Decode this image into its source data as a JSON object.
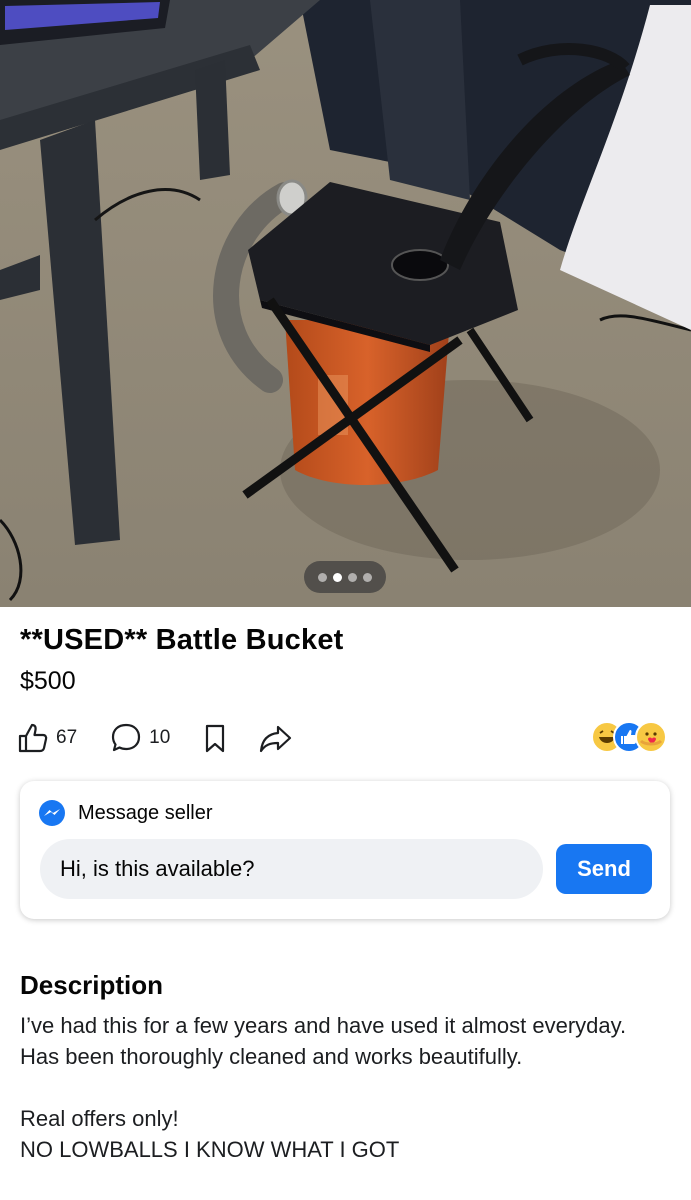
{
  "listing": {
    "title": "**USED** Battle Bucket",
    "price": "$500"
  },
  "gallery": {
    "photo_count": 4,
    "active_index": 2
  },
  "actions": {
    "like_count": "67",
    "comment_count": "10",
    "reactions": [
      "laughing-emoji",
      "like-emoji",
      "care-emoji"
    ]
  },
  "message": {
    "title": "Message seller",
    "input_value": "Hi, is this available?",
    "send_label": "Send"
  },
  "description": {
    "heading": "Description",
    "lines": [
      "I’ve had this for a few years and have used it almost everyday. Has been thoroughly cleaned and works beautifully.",
      "Real offers only!",
      "NO LOWBALLS I KNOW WHAT I GOT"
    ]
  },
  "colors": {
    "accent": "#1877f2",
    "input_bg": "#eff1f4",
    "bucket": "#c5521d"
  }
}
